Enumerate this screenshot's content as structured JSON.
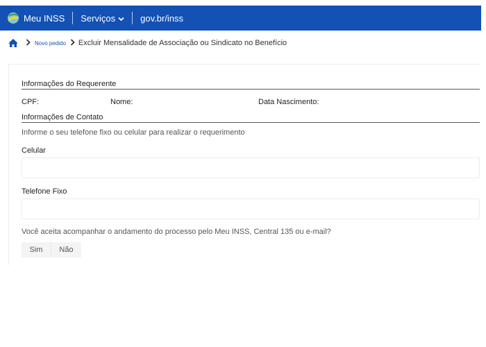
{
  "header": {
    "brand": "Meu INSS",
    "services_menu": "Serviços",
    "gov_link": "gov.br/inss"
  },
  "breadcrumb": {
    "link": "Novo pedido",
    "current": "Excluir Mensalidade de Associação ou Sindicato no Benefício"
  },
  "requerente": {
    "title": "Informações do Requerente",
    "cpf_label": "CPF:",
    "nome_label": "Nome:",
    "nascimento_label": "Data Nascimento:"
  },
  "contato": {
    "title": "Informações de Contato",
    "helper": "Informe o seu telefone fixo ou celular para realizar o requerimento",
    "celular_label": "Celular",
    "celular_value": "",
    "fixo_label": "Telefone Fixo",
    "fixo_value": ""
  },
  "acompanhamento": {
    "question": "Você aceita acompanhar o andamento do processo pelo Meu INSS, Central 135 ou e-mail?",
    "yes": "Sim",
    "no": "Não"
  },
  "colors": {
    "brand_blue": "#1351b4"
  },
  "icons": {
    "logo": "inss-logo-icon",
    "menu_chevron": "chevron-down-icon",
    "home": "home-icon",
    "breadcrumb_separator": "chevron-right-icon"
  }
}
